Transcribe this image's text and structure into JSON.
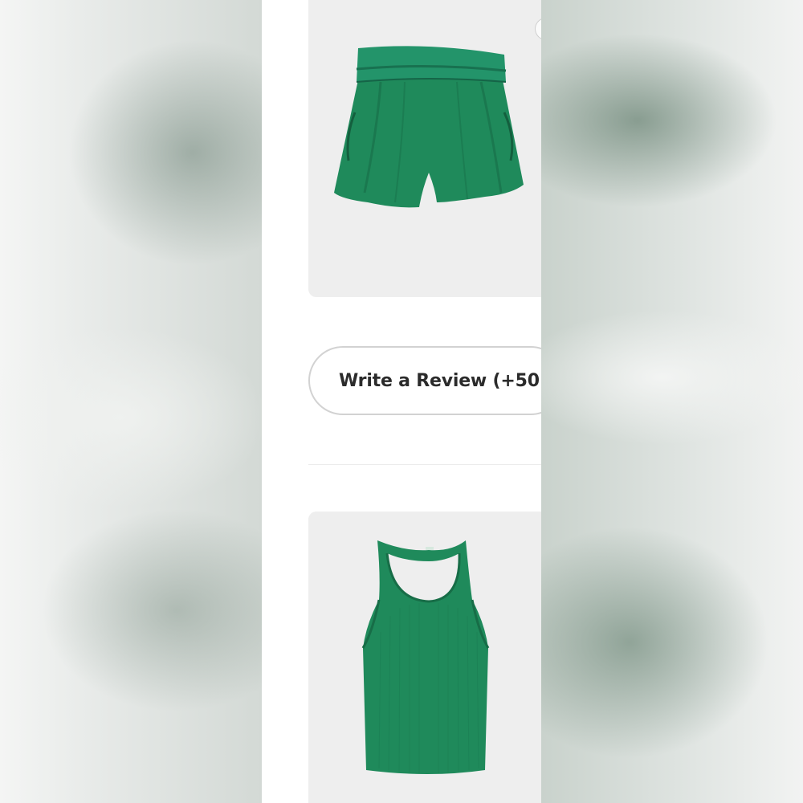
{
  "review": {
    "button_label": "Write a Review (+50"
  },
  "products": [
    {
      "name": "shorts",
      "image_icon": "green-shorts-image"
    },
    {
      "name": "tank",
      "image_icon": "green-racerback-tank-image"
    }
  ],
  "colors": {
    "garment_green": "#1f8a5b",
    "card_bg": "#eeeeee",
    "button_border": "#d2d2d2",
    "button_text": "#2b2b2b"
  }
}
